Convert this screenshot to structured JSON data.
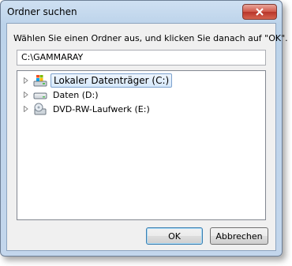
{
  "window": {
    "title": "Ordner suchen"
  },
  "dialog": {
    "instruction": "Wählen Sie einen Ordner aus, und klicken Sie danach auf \"OK\".",
    "path_value": "C:\\GAMMARAY"
  },
  "tree": {
    "items": [
      {
        "label": "Lokaler Datenträger (C:)",
        "icon": "windows-drive-icon",
        "selected": true
      },
      {
        "label": "Daten (D:)",
        "icon": "hard-drive-icon",
        "selected": false
      },
      {
        "label": "DVD-RW-Laufwerk (E:)",
        "icon": "dvd-drive-icon",
        "selected": false
      }
    ]
  },
  "buttons": {
    "ok_label": "OK",
    "cancel_label": "Abbrechen"
  },
  "colors": {
    "selection_border": "#7da2ce",
    "close_button": "#c9493a",
    "frame": "#bcd3ea"
  }
}
